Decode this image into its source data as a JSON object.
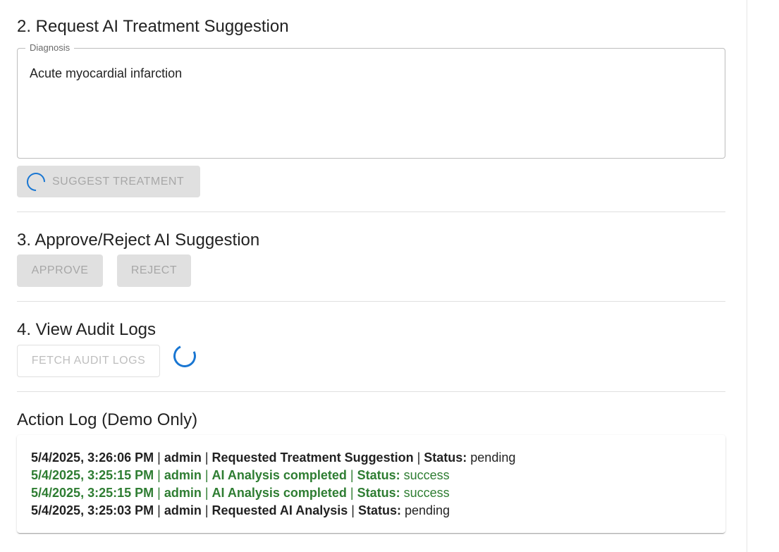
{
  "sections": {
    "suggest": {
      "title": "2. Request AI Treatment Suggestion",
      "field_label": "Diagnosis",
      "field_value": "Acute myocardial infarction",
      "button_label": "SUGGEST TREATMENT"
    },
    "approve": {
      "title": "3. Approve/Reject AI Suggestion",
      "approve_label": "APPROVE",
      "reject_label": "REJECT"
    },
    "audit": {
      "title": "4. View Audit Logs",
      "fetch_label": "FETCH AUDIT LOGS"
    },
    "action_log": {
      "title": "Action Log (Demo Only)",
      "entries": [
        {
          "timestamp": "5/4/2025, 3:26:06 PM",
          "sep1": " | ",
          "user": "admin",
          "sep2": " | ",
          "action": "Requested Treatment Suggestion",
          "sep3": " | ",
          "status_label": "Status:",
          "status": " pending",
          "status_type": "pending"
        },
        {
          "timestamp": "5/4/2025, 3:25:15 PM",
          "sep1": " | ",
          "user": "admin",
          "sep2": " | ",
          "action": "AI Analysis completed",
          "sep3": " | ",
          "status_label": "Status:",
          "status": " success",
          "status_type": "success"
        },
        {
          "timestamp": "5/4/2025, 3:25:15 PM",
          "sep1": " | ",
          "user": "admin",
          "sep2": " | ",
          "action": "AI Analysis completed",
          "sep3": " | ",
          "status_label": "Status:",
          "status": " success",
          "status_type": "success"
        },
        {
          "timestamp": "5/4/2025, 3:25:03 PM",
          "sep1": " | ",
          "user": "admin",
          "sep2": " | ",
          "action": "Requested AI Analysis",
          "sep3": " | ",
          "status_label": "Status:",
          "status": " pending",
          "status_type": "pending"
        }
      ]
    }
  },
  "colors": {
    "spinner": "#1976d2",
    "success": "#2e7d32",
    "disabled_bg": "#e0e0e0",
    "disabled_text": "rgba(0,0,0,0.26)"
  },
  "icons": {
    "suggest_loading": "loading-spinner-icon",
    "fetch_loading": "loading-spinner-icon"
  }
}
